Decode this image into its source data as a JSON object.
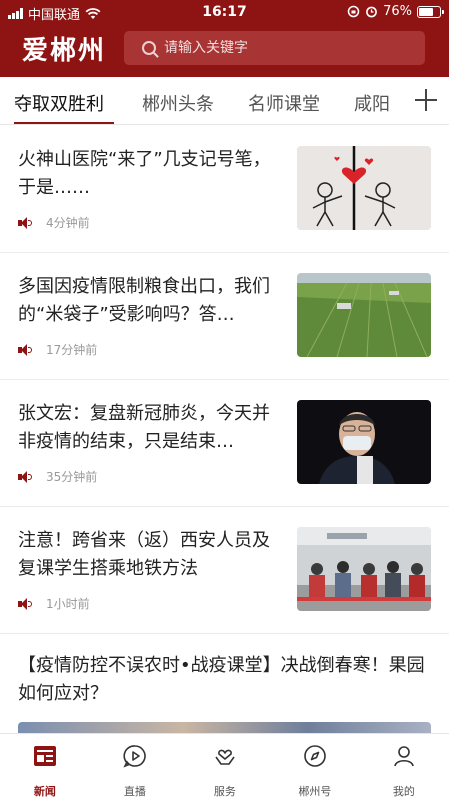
{
  "status_bar": {
    "carrier": "中国联通",
    "time": "16:17",
    "battery": "76%",
    "battery_level": 0.76
  },
  "header": {
    "logo": "爱郴州",
    "search_placeholder": "请输入关键字"
  },
  "tabs": [
    {
      "label": "夺取双胜利",
      "active": true
    },
    {
      "label": "郴州头条",
      "active": false
    },
    {
      "label": "名师课堂",
      "active": false
    },
    {
      "label": "咸阳",
      "active": false
    }
  ],
  "feed": [
    {
      "title": "火神山医院“来了”几支记号笔，于是……",
      "time": "4分钟前",
      "thumb": "cartoon-figures-heart"
    },
    {
      "title": "多国因疫情限制粮食出口，我们的“米袋子”受影响吗？答…",
      "time": "17分钟前",
      "thumb": "green-farm-field"
    },
    {
      "title": "张文宏：复盘新冠肺炎，今天并非疫情的结束，只是结束…",
      "time": "35分钟前",
      "thumb": "man-with-mask"
    },
    {
      "title": "注意！跨省来（返）西安人员及复课学生搭乘地铁方法",
      "time": "1小时前",
      "thumb": "subway-station-crowd"
    },
    {
      "title": "【疫情防控不误农时•战疫课堂】决战倒春寒！果园如何应对？",
      "thumb": "orchard-blossoms"
    }
  ],
  "bottom_nav": [
    {
      "label": "新闻",
      "icon": "news-icon",
      "active": true
    },
    {
      "label": "直播",
      "icon": "live-play-icon",
      "active": false
    },
    {
      "label": "服务",
      "icon": "service-heart-icon",
      "active": false
    },
    {
      "label": "郴州号",
      "icon": "compass-icon",
      "active": false
    },
    {
      "label": "我的",
      "icon": "profile-icon",
      "active": false
    }
  ],
  "colors": {
    "brand": "#8e1414",
    "search_bg": "#a83434"
  }
}
